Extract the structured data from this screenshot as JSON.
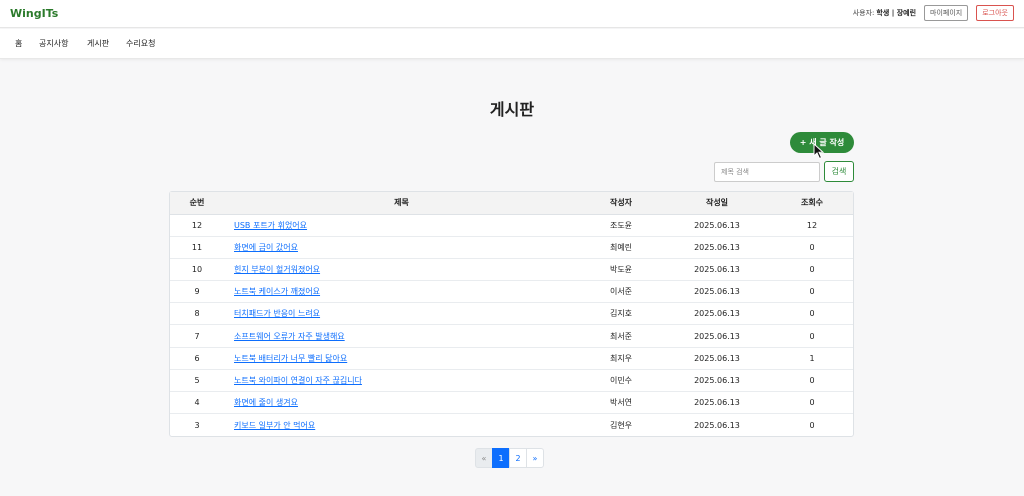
{
  "header": {
    "brand": "WingITs",
    "user_label": "사용자:",
    "user_name": "학생 | 장예린",
    "mypage_label": "마이페이지",
    "logout_label": "로그아웃"
  },
  "nav": {
    "items": [
      {
        "label": "홈"
      },
      {
        "label": "공지사항"
      },
      {
        "label": "게시판"
      },
      {
        "label": "수리요청"
      }
    ]
  },
  "main": {
    "title": "게시판",
    "new_post_label": "+ 새 글 작성",
    "search_placeholder": "제목 검색",
    "search_button": "검색"
  },
  "table": {
    "columns": [
      "순번",
      "제목",
      "작성자",
      "작성일",
      "조회수"
    ],
    "rows": [
      {
        "no": "12",
        "title": "USB 포트가 휘었어요",
        "author": "조도윤",
        "date": "2025.06.13",
        "views": "12"
      },
      {
        "no": "11",
        "title": "화면에 금이 갔어요",
        "author": "최예린",
        "date": "2025.06.13",
        "views": "0"
      },
      {
        "no": "10",
        "title": "힌지 부분이 헐거워졌어요",
        "author": "박도윤",
        "date": "2025.06.13",
        "views": "0"
      },
      {
        "no": "9",
        "title": "노트북 케이스가 깨졌어요",
        "author": "이서준",
        "date": "2025.06.13",
        "views": "0"
      },
      {
        "no": "8",
        "title": "터치패드가 반응이 느려요",
        "author": "김지호",
        "date": "2025.06.13",
        "views": "0"
      },
      {
        "no": "7",
        "title": "소프트웨어 오류가 자주 발생해요",
        "author": "최서준",
        "date": "2025.06.13",
        "views": "0"
      },
      {
        "no": "6",
        "title": "노트북 배터리가 너무 빨리 닳아요",
        "author": "최지우",
        "date": "2025.06.13",
        "views": "1"
      },
      {
        "no": "5",
        "title": "노트북 와이파이 연결이 자주 끊깁니다",
        "author": "이민수",
        "date": "2025.06.13",
        "views": "0"
      },
      {
        "no": "4",
        "title": "화면에 줄이 생겨요",
        "author": "박서연",
        "date": "2025.06.13",
        "views": "0"
      },
      {
        "no": "3",
        "title": "키보드 일부가 안 먹어요",
        "author": "김현우",
        "date": "2025.06.13",
        "views": "0"
      }
    ]
  },
  "pagination": {
    "prev": "«",
    "pages": [
      "1",
      "2"
    ],
    "current": "1",
    "next": "»"
  },
  "colors": {
    "brand": "#2b7a2b",
    "primary_green": "#2e8b3a",
    "link_blue": "#0d6efd",
    "logout_red": "#d9534f"
  }
}
